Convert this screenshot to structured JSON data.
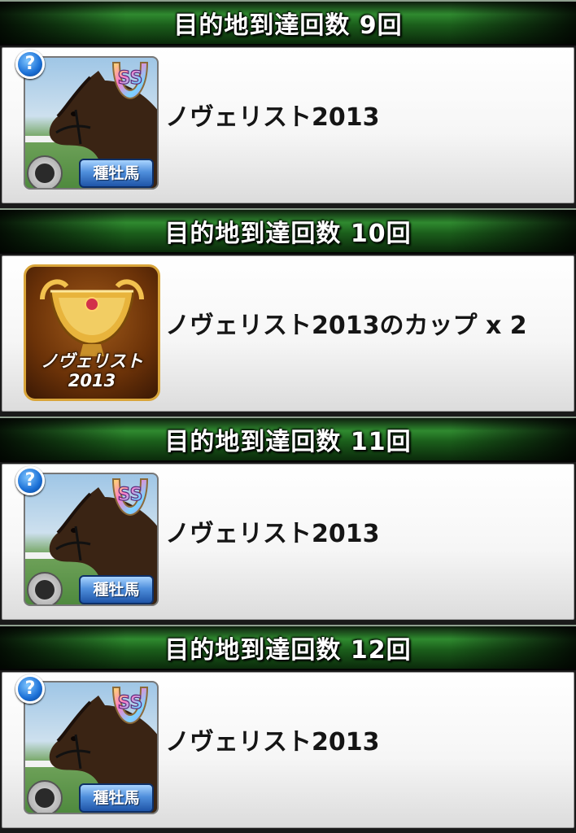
{
  "sections": [
    {
      "header": "目的地到達回数 9回",
      "item_name": "ノヴェリスト2013",
      "item_kind": "horse-card",
      "rank": "SS",
      "type_badge": "種牡馬",
      "help_badge": "?"
    },
    {
      "header": "目的地到達回数 10回",
      "item_name": "ノヴェリスト2013のカップ x 2",
      "item_kind": "cup",
      "cup_label": [
        "ノヴェリスト",
        "2013"
      ]
    },
    {
      "header": "目的地到達回数 11回",
      "item_name": "ノヴェリスト2013",
      "item_kind": "horse-card",
      "rank": "SS",
      "type_badge": "種牡馬",
      "help_badge": "?"
    },
    {
      "header": "目的地到達回数 12回",
      "item_name": "ノヴェリスト2013",
      "item_kind": "horse-card",
      "rank": "SS",
      "type_badge": "種牡馬",
      "help_badge": "?"
    }
  ],
  "colors": {
    "header_green": "#2f8a2f",
    "type_badge_blue": "#1f55a8",
    "help_badge_blue": "#1a6fd6",
    "cup_gold": "#d9a53a"
  }
}
